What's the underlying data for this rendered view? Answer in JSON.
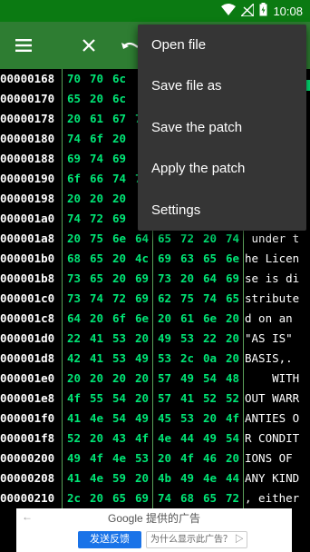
{
  "status": {
    "time": "10:08"
  },
  "toolbar": {
    "menu_icon": "hamburger-menu-icon",
    "close_icon": "close-icon",
    "undo_icon": "undo-icon"
  },
  "menu": {
    "items": [
      "Open file",
      "Save file as",
      "Save the patch",
      "Apply the patch",
      "Settings"
    ]
  },
  "hex_rows": [
    {
      "addr": "00000168",
      "bytes": [
        "70",
        "70",
        "6c",
        "",
        "",
        "",
        "",
        ""
      ],
      "ascii": ""
    },
    {
      "addr": "00000170",
      "bytes": [
        "65",
        "20",
        "6c",
        "",
        "",
        "",
        "",
        ""
      ],
      "ascii": ""
    },
    {
      "addr": "00000178",
      "bytes": [
        "20",
        "61",
        "67",
        "7",
        "",
        "",
        "",
        ""
      ],
      "ascii": ""
    },
    {
      "addr": "00000180",
      "bytes": [
        "74",
        "6f",
        "20",
        "",
        "",
        "",
        "",
        ""
      ],
      "ascii": ""
    },
    {
      "addr": "00000188",
      "bytes": [
        "69",
        "74",
        "69",
        "",
        "",
        "",
        "",
        ""
      ],
      "ascii": ""
    },
    {
      "addr": "00000190",
      "bytes": [
        "6f",
        "66",
        "74",
        "7",
        "",
        "",
        "",
        ""
      ],
      "ascii": ""
    },
    {
      "addr": "00000198",
      "bytes": [
        "20",
        "20",
        "20",
        "",
        "",
        "",
        "",
        ""
      ],
      "ascii": ""
    },
    {
      "addr": "000001a0",
      "bytes": [
        "74",
        "72",
        "69",
        "",
        "",
        "",
        "",
        ""
      ],
      "ascii": ""
    },
    {
      "addr": "000001a8",
      "bytes": [
        "20",
        "75",
        "6e",
        "64",
        "65",
        "72",
        "20",
        "74"
      ],
      "ascii": " under t"
    },
    {
      "addr": "000001b0",
      "bytes": [
        "68",
        "65",
        "20",
        "4c",
        "69",
        "63",
        "65",
        "6e"
      ],
      "ascii": "he Licen"
    },
    {
      "addr": "000001b8",
      "bytes": [
        "73",
        "65",
        "20",
        "69",
        "73",
        "20",
        "64",
        "69"
      ],
      "ascii": "se is di"
    },
    {
      "addr": "000001c0",
      "bytes": [
        "73",
        "74",
        "72",
        "69",
        "62",
        "75",
        "74",
        "65"
      ],
      "ascii": "stribute"
    },
    {
      "addr": "000001c8",
      "bytes": [
        "64",
        "20",
        "6f",
        "6e",
        "20",
        "61",
        "6e",
        "20"
      ],
      "ascii": "d on an "
    },
    {
      "addr": "000001d0",
      "bytes": [
        "22",
        "41",
        "53",
        "20",
        "49",
        "53",
        "22",
        "20"
      ],
      "ascii": "\"AS IS\" "
    },
    {
      "addr": "000001d8",
      "bytes": [
        "42",
        "41",
        "53",
        "49",
        "53",
        "2c",
        "0a",
        "20"
      ],
      "ascii": "BASIS,. "
    },
    {
      "addr": "000001e0",
      "bytes": [
        "20",
        "20",
        "20",
        "20",
        "57",
        "49",
        "54",
        "48"
      ],
      "ascii": "    WITH"
    },
    {
      "addr": "000001e8",
      "bytes": [
        "4f",
        "55",
        "54",
        "20",
        "57",
        "41",
        "52",
        "52"
      ],
      "ascii": "OUT WARR"
    },
    {
      "addr": "000001f0",
      "bytes": [
        "41",
        "4e",
        "54",
        "49",
        "45",
        "53",
        "20",
        "4f"
      ],
      "ascii": "ANTIES O"
    },
    {
      "addr": "000001f8",
      "bytes": [
        "52",
        "20",
        "43",
        "4f",
        "4e",
        "44",
        "49",
        "54"
      ],
      "ascii": "R CONDIT"
    },
    {
      "addr": "00000200",
      "bytes": [
        "49",
        "4f",
        "4e",
        "53",
        "20",
        "4f",
        "46",
        "20"
      ],
      "ascii": "IONS OF "
    },
    {
      "addr": "00000208",
      "bytes": [
        "41",
        "4e",
        "59",
        "20",
        "4b",
        "49",
        "4e",
        "44"
      ],
      "ascii": "ANY KIND"
    },
    {
      "addr": "00000210",
      "bytes": [
        "2c",
        "20",
        "65",
        "69",
        "74",
        "68",
        "65",
        "72"
      ],
      "ascii": ", either"
    }
  ],
  "ad": {
    "back_arrow": "←",
    "title": "Google 提供的广告",
    "feedback": "发送反馈",
    "why": "为什么显示此广告？ ▷"
  }
}
